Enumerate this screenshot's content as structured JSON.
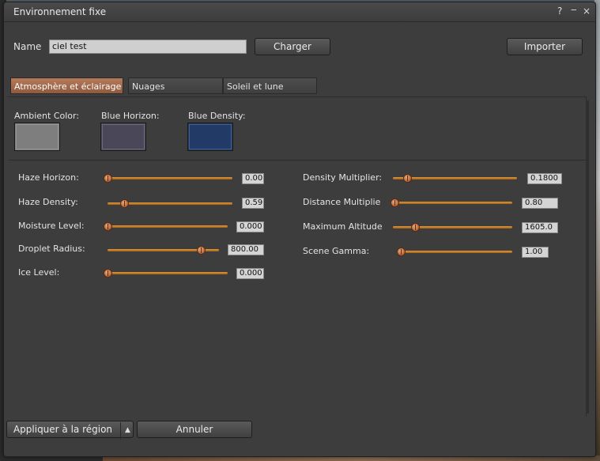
{
  "window": {
    "title": "Environnement fixe",
    "help": "?",
    "minimize": "‒",
    "close": "×"
  },
  "top": {
    "name_label": "Name",
    "name_value": "ciel test",
    "load_button": "Charger",
    "import_button": "Importer"
  },
  "tabs": [
    {
      "label": "Atmosphère et éclairage",
      "active": true
    },
    {
      "label": "Nuages",
      "active": false
    },
    {
      "label": "Soleil et lune",
      "active": false
    }
  ],
  "colors": {
    "ambient": {
      "label": "Ambient Color:",
      "hex": "#7e7e7e"
    },
    "blue_horizon": {
      "label": "Blue Horizon:",
      "hex": "#4a4858"
    },
    "blue_density": {
      "label": "Blue Density:",
      "hex": "#213a66"
    }
  },
  "sliders_left": [
    {
      "label": "Haze Horizon:",
      "value": "0.00",
      "fraction": 0.0
    },
    {
      "label": "Haze Density:",
      "value": "0.59",
      "fraction": 0.1
    },
    {
      "label": "Moisture Level:",
      "value": "0.000",
      "fraction": 0.0
    },
    {
      "label": "Droplet Radius:",
      "value": "800.00",
      "fraction": 0.8
    },
    {
      "label": "Ice Level:",
      "value": "0.000",
      "fraction": 0.0
    }
  ],
  "sliders_right": [
    {
      "label": "Density Multiplier:",
      "value": "0.1800",
      "fraction": 0.08
    },
    {
      "label": "Distance Multiplie",
      "value": "0.80",
      "fraction": 0.0
    },
    {
      "label": "Maximum Altitude",
      "value": "1605.0",
      "fraction": 0.15
    },
    {
      "label": "Scene Gamma:",
      "value": "1.00",
      "fraction": 0.0
    }
  ],
  "footer": {
    "apply_button": "Appliquer à la région",
    "apply_dropdown": "▲",
    "cancel_button": "Annuler"
  }
}
